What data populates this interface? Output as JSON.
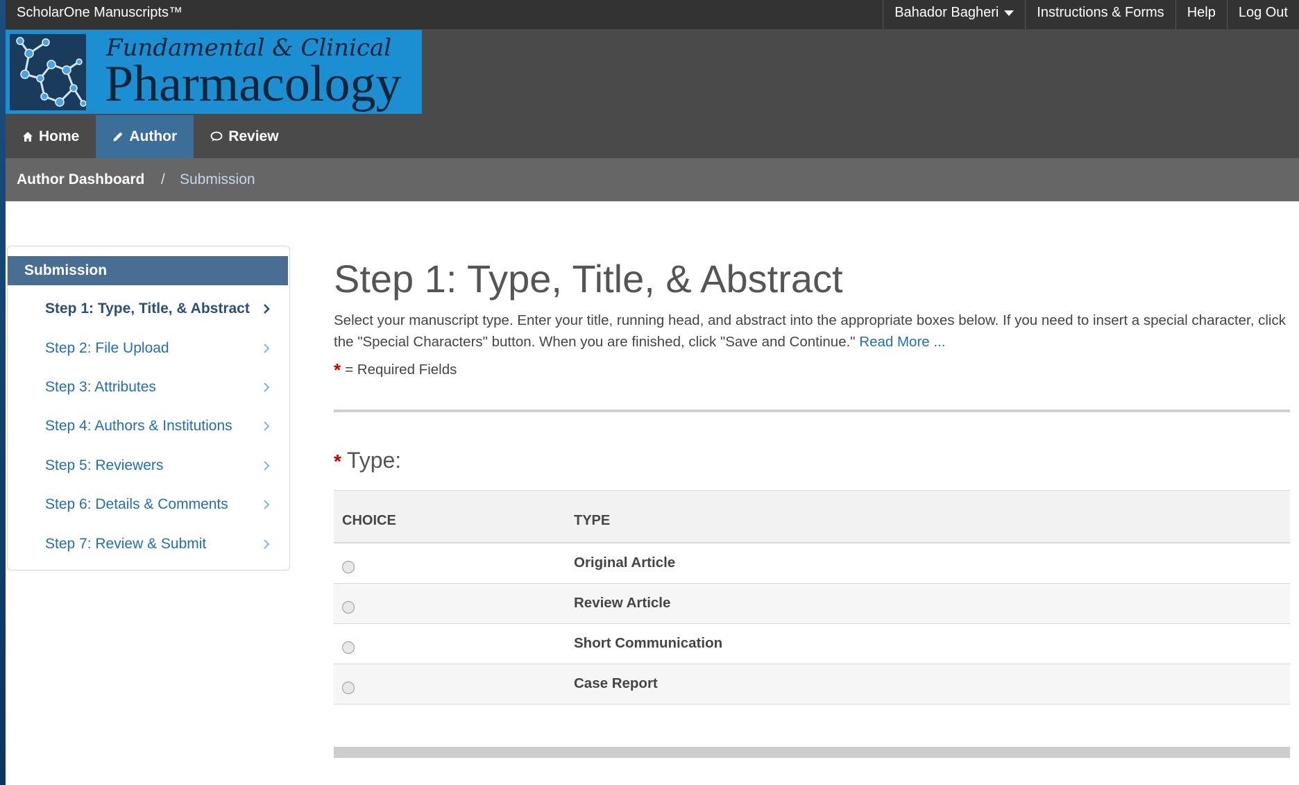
{
  "app": {
    "brand": "ScholarOne Manuscripts™"
  },
  "topnav": {
    "user": "Bahador Bagheri",
    "instructions": "Instructions & Forms",
    "help": "Help",
    "logout": "Log Out"
  },
  "journal": {
    "line1": "Fundamental & Clinical",
    "line2": "Pharmacology"
  },
  "mainnav": {
    "home": "Home",
    "author": "Author",
    "review": "Review"
  },
  "breadcrumb": {
    "root": "Author Dashboard",
    "separator": "/",
    "current": "Submission"
  },
  "sidebar": {
    "title": "Submission",
    "items": [
      {
        "label": "Step 1: Type, Title, & Abstract",
        "current": true
      },
      {
        "label": "Step 2: File Upload"
      },
      {
        "label": "Step 3: Attributes"
      },
      {
        "label": "Step 4: Authors & Institutions"
      },
      {
        "label": "Step 5: Reviewers"
      },
      {
        "label": "Step 6: Details & Comments"
      },
      {
        "label": "Step 7: Review & Submit"
      }
    ]
  },
  "main": {
    "title": "Step 1: Type, Title, & Abstract",
    "intro": "Select your manuscript type. Enter your title, running head, and abstract into the appropriate boxes below. If you need to insert a special character, click the \"Special Characters\" button. When you are finished, click \"Save and Continue.\"",
    "read_more": "Read More ...",
    "required_star": "*",
    "required_note": "= Required Fields",
    "type_label": "Type:",
    "table": {
      "headers": [
        "CHOICE",
        "TYPE"
      ],
      "rows": [
        {
          "type": "Original Article"
        },
        {
          "type": "Review Article"
        },
        {
          "type": "Short Communication"
        },
        {
          "type": "Case Report"
        }
      ]
    }
  },
  "colors": {
    "accent": "#1b8fd2",
    "nav_active": "#3c6e9a",
    "link": "#1f6fb2",
    "required": "#cc0000"
  },
  "icons": [
    "home-icon",
    "pencil-icon",
    "comment-icon",
    "chevron-right-icon",
    "chevron-down-icon",
    "molecule-logo"
  ]
}
